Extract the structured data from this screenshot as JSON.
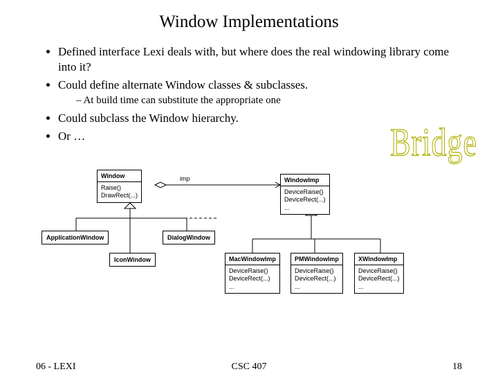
{
  "title": "Window Implementations",
  "bullets": {
    "b1": "Defined interface Lexi deals with, but where does the real windowing library come into it?",
    "b2": "Could define alternate Window classes & subclasses.",
    "b2s1": "At build time can substitute the appropriate one",
    "b3": "Could subclass the Window hierarchy.",
    "b4": "Or …"
  },
  "bridge": "Bridge",
  "uml": {
    "window": {
      "name": "Window",
      "ops": "Raise()\nDrawRect(...)"
    },
    "imp_label": "imp",
    "windowimp": {
      "name": "WindowImp",
      "ops": "DeviceRaise()\nDeviceRect(...)\n..."
    },
    "appwin": "ApplicationWindow",
    "dlgwin": "DialogWindow",
    "iconwin": "IconWindow",
    "mac": {
      "name": "MacWindowImp",
      "ops": "DeviceRaise()\nDeviceRect(...)\n..."
    },
    "pm": {
      "name": "PMWindowImp",
      "ops": "DeviceRaise()\nDeviceRect(...)\n..."
    },
    "x": {
      "name": "XWindowImp",
      "ops": "DeviceRaise()\nDeviceRect(...)\n..."
    }
  },
  "footer": {
    "left": "06 - LEXI",
    "mid": "CSC 407",
    "right": "18"
  }
}
